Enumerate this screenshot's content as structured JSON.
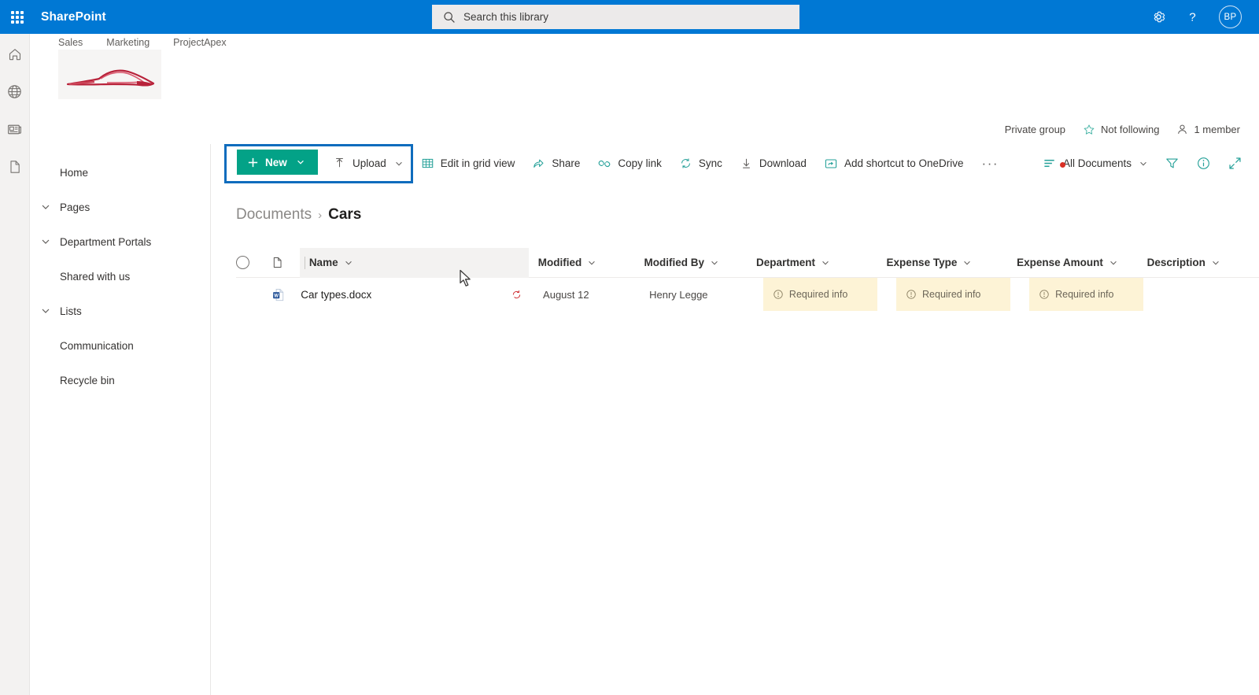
{
  "suite": {
    "waffle_label": "app-launcher",
    "brand": "SharePoint",
    "search_placeholder": "Search this library",
    "search_value": "",
    "settings_label": "Settings",
    "help_label": "Help",
    "avatar_initials": "BP"
  },
  "rail": {
    "items": [
      {
        "name": "home-icon",
        "label": "Home"
      },
      {
        "name": "globe-icon",
        "label": "My sites"
      },
      {
        "name": "news-icon",
        "label": "News"
      },
      {
        "name": "document-icon",
        "label": "Files"
      }
    ]
  },
  "site": {
    "nav": [
      {
        "label": "Sales"
      },
      {
        "label": "Marketing"
      },
      {
        "label": "ProjectApex"
      }
    ],
    "logo_alt": "car-logo"
  },
  "group_info": {
    "privacy": "Private group",
    "follow": "Not following",
    "members": "1 member"
  },
  "left_nav": {
    "items": [
      {
        "label": "Home",
        "expandable": false
      },
      {
        "label": "Pages",
        "expandable": true
      },
      {
        "label": "Department Portals",
        "expandable": true
      },
      {
        "label": "Shared with us",
        "expandable": false
      },
      {
        "label": "Lists",
        "expandable": true
      },
      {
        "label": "Communication",
        "expandable": false
      },
      {
        "label": "Recycle bin",
        "expandable": false
      }
    ]
  },
  "command_bar": {
    "new_label": "New",
    "upload_label": "Upload",
    "edit_grid_label": "Edit in grid view",
    "share_label": "Share",
    "copy_link_label": "Copy link",
    "sync_label": "Sync",
    "download_label": "Download",
    "add_shortcut_label": "Add shortcut to OneDrive",
    "overflow_label": "···",
    "view_label": "All Documents",
    "filter_label": "Filters",
    "info_label": "Details",
    "expand_label": "Expand",
    "new_button_color": "#03a287",
    "highlight_color": "#0f6cbd"
  },
  "breadcrumb": {
    "root": "Documents",
    "separator": "›",
    "current": "Cars"
  },
  "table": {
    "columns": [
      {
        "key": "name",
        "label": "Name"
      },
      {
        "key": "modified",
        "label": "Modified"
      },
      {
        "key": "modified_by",
        "label": "Modified By"
      },
      {
        "key": "department",
        "label": "Department"
      },
      {
        "key": "expense_type",
        "label": "Expense Type"
      },
      {
        "key": "expense_amount",
        "label": "Expense Amount"
      },
      {
        "key": "description",
        "label": "Description"
      }
    ],
    "required_text": "Required info",
    "rows": [
      {
        "file_icon": "word-doc-icon",
        "name": "Car types.docx",
        "shared_icon": "sensitivity-icon",
        "modified": "August 12",
        "modified_by": "Henry Legge",
        "department": "Required info",
        "expense_type": "Required info",
        "expense_amount": "Required info",
        "description": "",
        "required_cell_color": "#fdf3d6"
      }
    ]
  }
}
